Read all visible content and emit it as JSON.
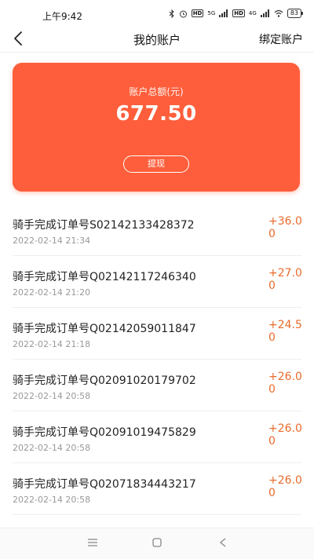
{
  "status_bar": {
    "time": "上午9:42",
    "net_label": "5G",
    "hd_label": "HD",
    "net_label2": "4G",
    "battery": "83"
  },
  "nav": {
    "title": "我的账户",
    "action": "绑定账户"
  },
  "balance": {
    "label": "账户总额(元)",
    "value": "677.50",
    "withdraw_label": "提现"
  },
  "transactions": [
    {
      "title": "骑手完成订单号S02142133428372",
      "time": "2022-02-14 21:34",
      "amount": "+36.00"
    },
    {
      "title": "骑手完成订单号Q02142117246340",
      "time": "2022-02-14 21:20",
      "amount": "+27.00"
    },
    {
      "title": "骑手完成订单号Q02142059011847",
      "time": "2022-02-14 21:18",
      "amount": "+24.50"
    },
    {
      "title": "骑手完成订单号Q02091020179702",
      "time": "2022-02-14 20:58",
      "amount": "+26.00"
    },
    {
      "title": "骑手完成订单号Q02091019475829",
      "time": "2022-02-14 20:58",
      "amount": "+26.00"
    },
    {
      "title": "骑手完成订单号Q02071834443217",
      "time": "2022-02-14 20:58",
      "amount": "+26.00"
    }
  ],
  "colors": {
    "accent": "#fe5e3b",
    "amount": "#e96b2c"
  }
}
